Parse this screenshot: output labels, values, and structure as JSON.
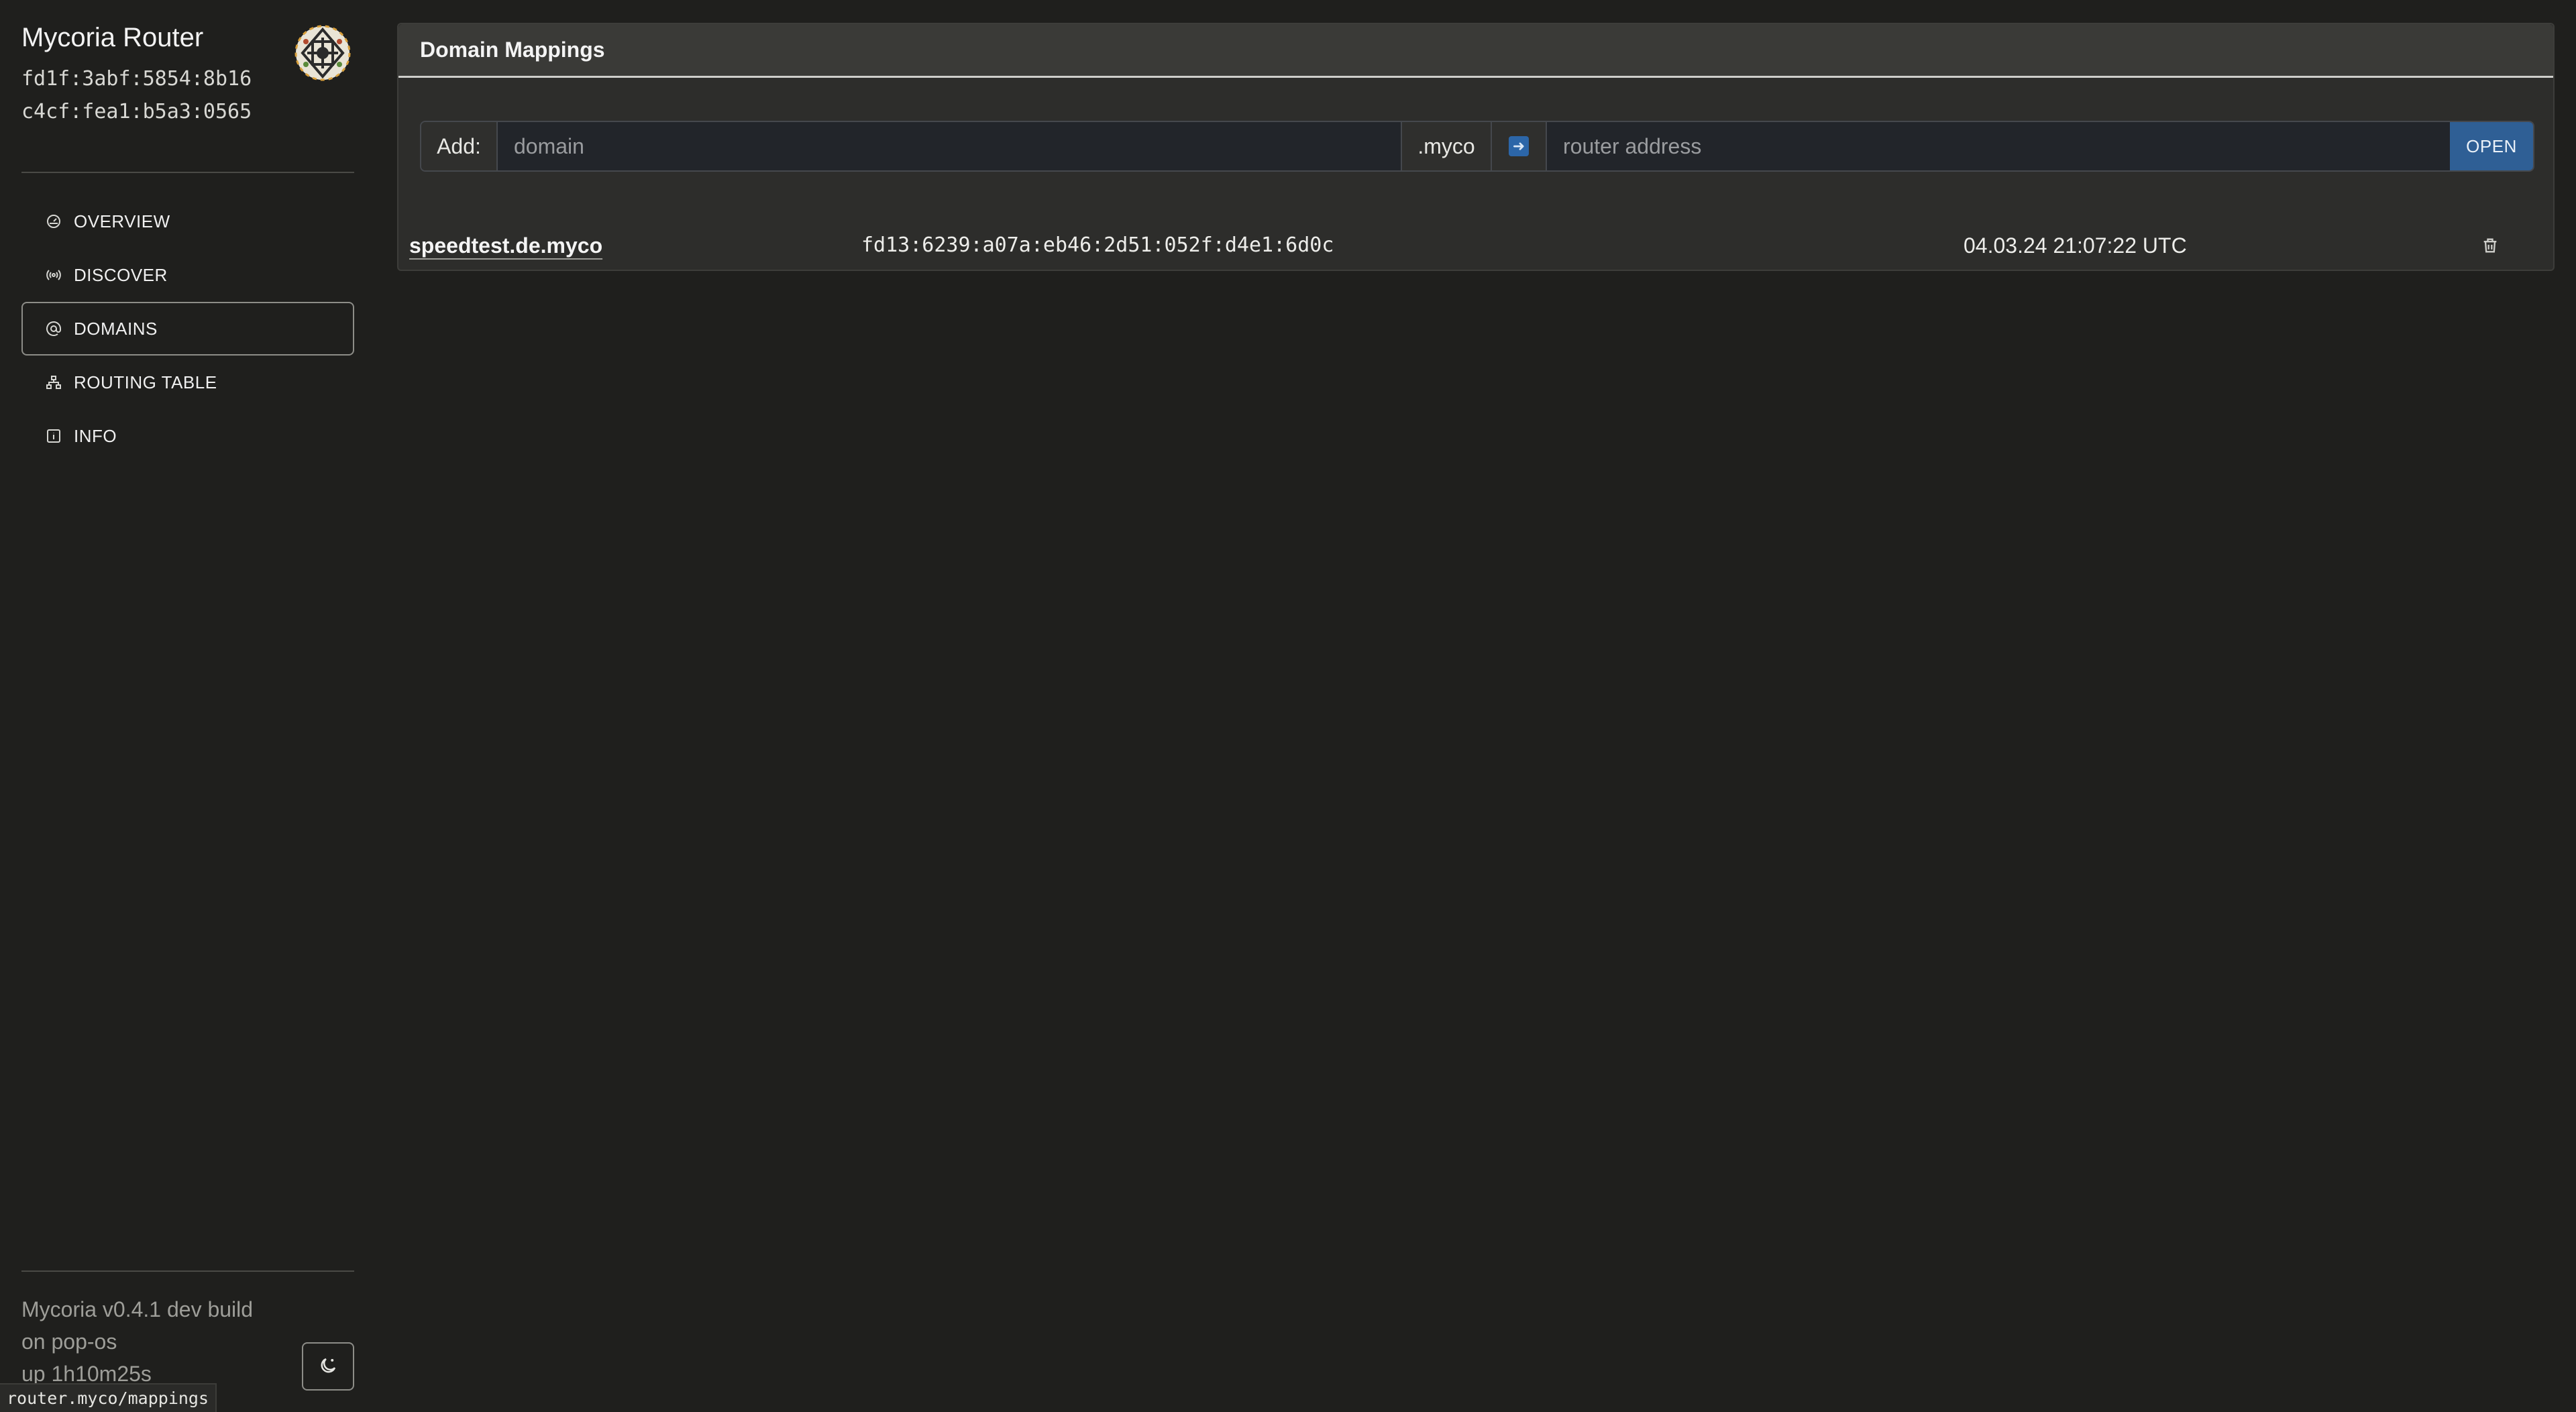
{
  "app": {
    "title": "Mycoria Router",
    "address_line1": "fd1f:3abf:5854:8b16",
    "address_line2": "c4cf:fea1:b5a3:0565"
  },
  "nav": {
    "items": [
      {
        "label": "OVERVIEW",
        "icon": "dashboard-icon",
        "active": false
      },
      {
        "label": "DISCOVER",
        "icon": "broadcast-icon",
        "active": false
      },
      {
        "label": "DOMAINS",
        "icon": "at-icon",
        "active": true
      },
      {
        "label": "ROUTING TABLE",
        "icon": "sitemap-icon",
        "active": false
      },
      {
        "label": "INFO",
        "icon": "info-icon",
        "active": false
      }
    ]
  },
  "footer": {
    "version": "Mycoria v0.4.1 dev build",
    "host": "on pop-os",
    "uptime": "up 1h10m25s"
  },
  "statusbar": {
    "url": "router.myco/mappings"
  },
  "panel": {
    "title": "Domain Mappings",
    "add_label": "Add:",
    "domain_placeholder": "domain",
    "suffix": ".myco",
    "router_placeholder": "router address",
    "open_label": "OPEN"
  },
  "mappings": [
    {
      "domain": "speedtest.de.myco",
      "address": "fd13:6239:a07a:eb46:2d51:052f:d4e1:6d0c",
      "time": "04.03.24 21:07:22 UTC"
    }
  ],
  "colors": {
    "background": "#1f1f1d",
    "panel": "#2d2d2b",
    "accent": "#2f5f95"
  }
}
